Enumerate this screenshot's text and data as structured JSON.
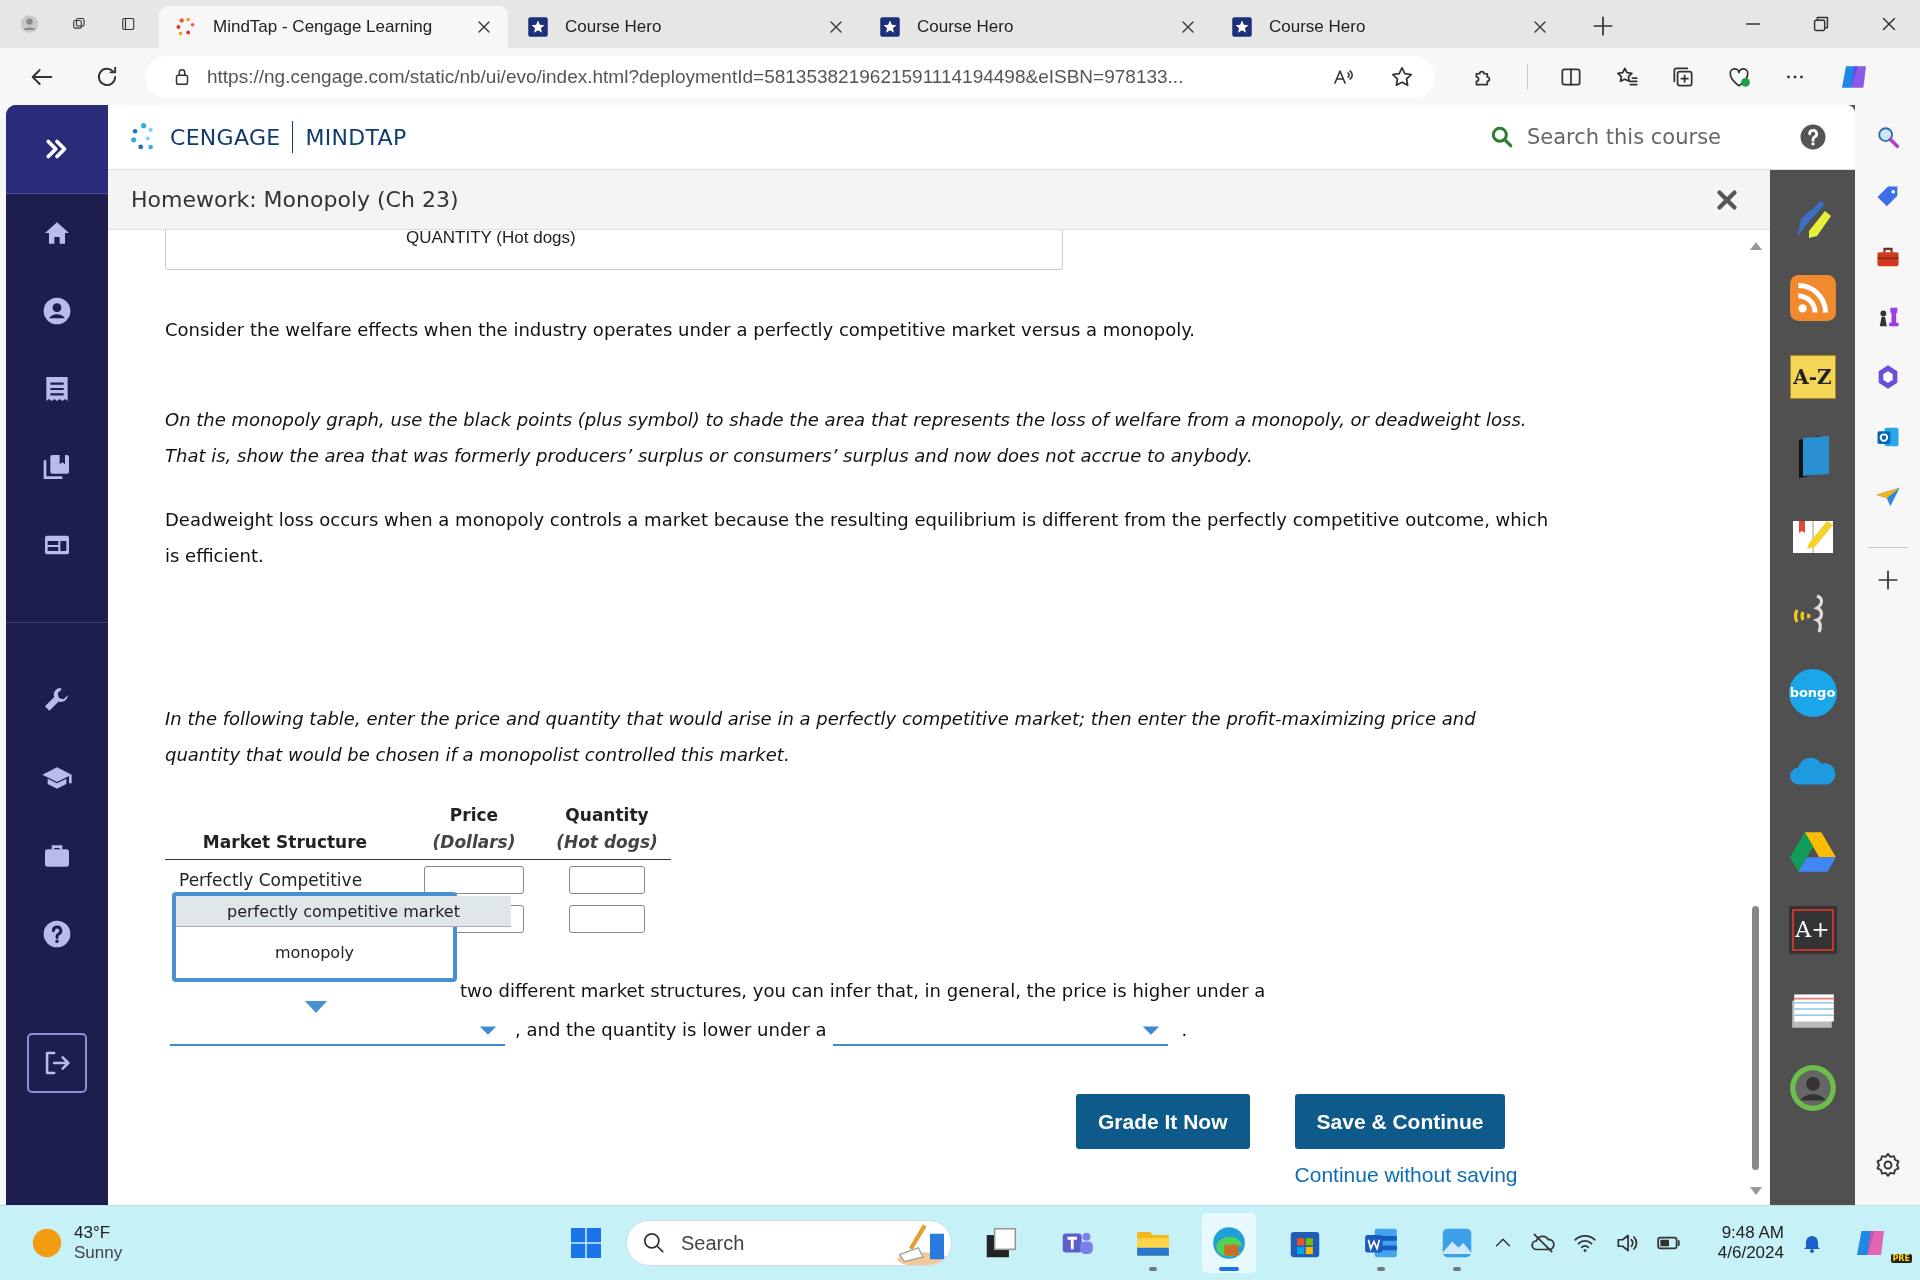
{
  "browser": {
    "tabs": [
      {
        "title": "MindTap - Cengage Learning",
        "selected": true
      },
      {
        "title": "Course Hero",
        "selected": false
      },
      {
        "title": "Course Hero",
        "selected": false
      },
      {
        "title": "Course Hero",
        "selected": false
      }
    ],
    "url": "https://ng.cengage.com/static/nb/ui/evo/index.html?deploymentId=5813538219621591114194498&eISBN=978133..."
  },
  "app": {
    "brand": {
      "company": "CENGAGE",
      "product": "MINDTAP"
    },
    "search": {
      "placeholder": "Search this course"
    },
    "title": "Homework: Monopoly (Ch 23)"
  },
  "content": {
    "graph_axis_label": "QUANTITY (Hot dogs)",
    "paragraphs": [
      {
        "text": "Consider the welfare effects when the industry operates under a perfectly competitive market versus a monopoly.",
        "italic": false
      },
      {
        "text": "On the monopoly graph, use the black points (plus symbol) to shade the area that represents the loss of welfare from a monopoly, or deadweight loss. That is, show the area that was formerly producers’ surplus or consumers’ surplus and now does not accrue to anybody.",
        "italic": true
      },
      {
        "text": "Deadweight loss occurs when a monopoly controls a market because the resulting equilibrium is different from the perfectly competitive outcome, which is efficient.",
        "italic": false
      },
      {
        "text": "In the following table, enter the price and quantity that would arise in a perfectly competitive market; then enter the profit-maximizing price and quantity that would be chosen if a monopolist controlled this market.",
        "italic": true
      }
    ],
    "table": {
      "columns": [
        {
          "title": "Market Structure"
        },
        {
          "title": "Price",
          "unit": "(Dollars)"
        },
        {
          "title": "Quantity",
          "unit": "(Hot dogs)"
        }
      ],
      "rows": [
        {
          "label": "Perfectly Competitive"
        },
        {}
      ]
    },
    "dropdown_menu": {
      "options": [
        {
          "label": "perfectly competitive market",
          "selected": true
        },
        {
          "label": "monopoly",
          "selected": false
        }
      ]
    },
    "conclusion": {
      "line_1": "two different market structures, you can infer that, in general, the price is higher under a",
      "middle": ", and the quantity is lower under a",
      "end": "."
    },
    "buttons": [
      {
        "label": "Grade It Now"
      },
      {
        "label": "Save & Continue"
      }
    ],
    "link": "Continue without saving"
  },
  "dock": {
    "items": [
      {
        "kind": "pencil"
      },
      {
        "kind": "rss"
      },
      {
        "kind": "glossary",
        "label": "A-Z"
      },
      {
        "kind": "book"
      },
      {
        "kind": "notes"
      },
      {
        "kind": "speaker"
      },
      {
        "kind": "bongo",
        "label": "bongo"
      },
      {
        "kind": "cloud"
      },
      {
        "kind": "drive"
      },
      {
        "kind": "grade",
        "label": "A+"
      },
      {
        "kind": "cards"
      },
      {
        "kind": "avatar"
      }
    ]
  },
  "taskbar": {
    "weather": {
      "temperature": "43°F",
      "condition": "Sunny"
    },
    "search": {
      "placeholder": "Search"
    },
    "time": "9:48 AM",
    "date": "4/6/2024",
    "copilot_badge": "PRE"
  }
}
